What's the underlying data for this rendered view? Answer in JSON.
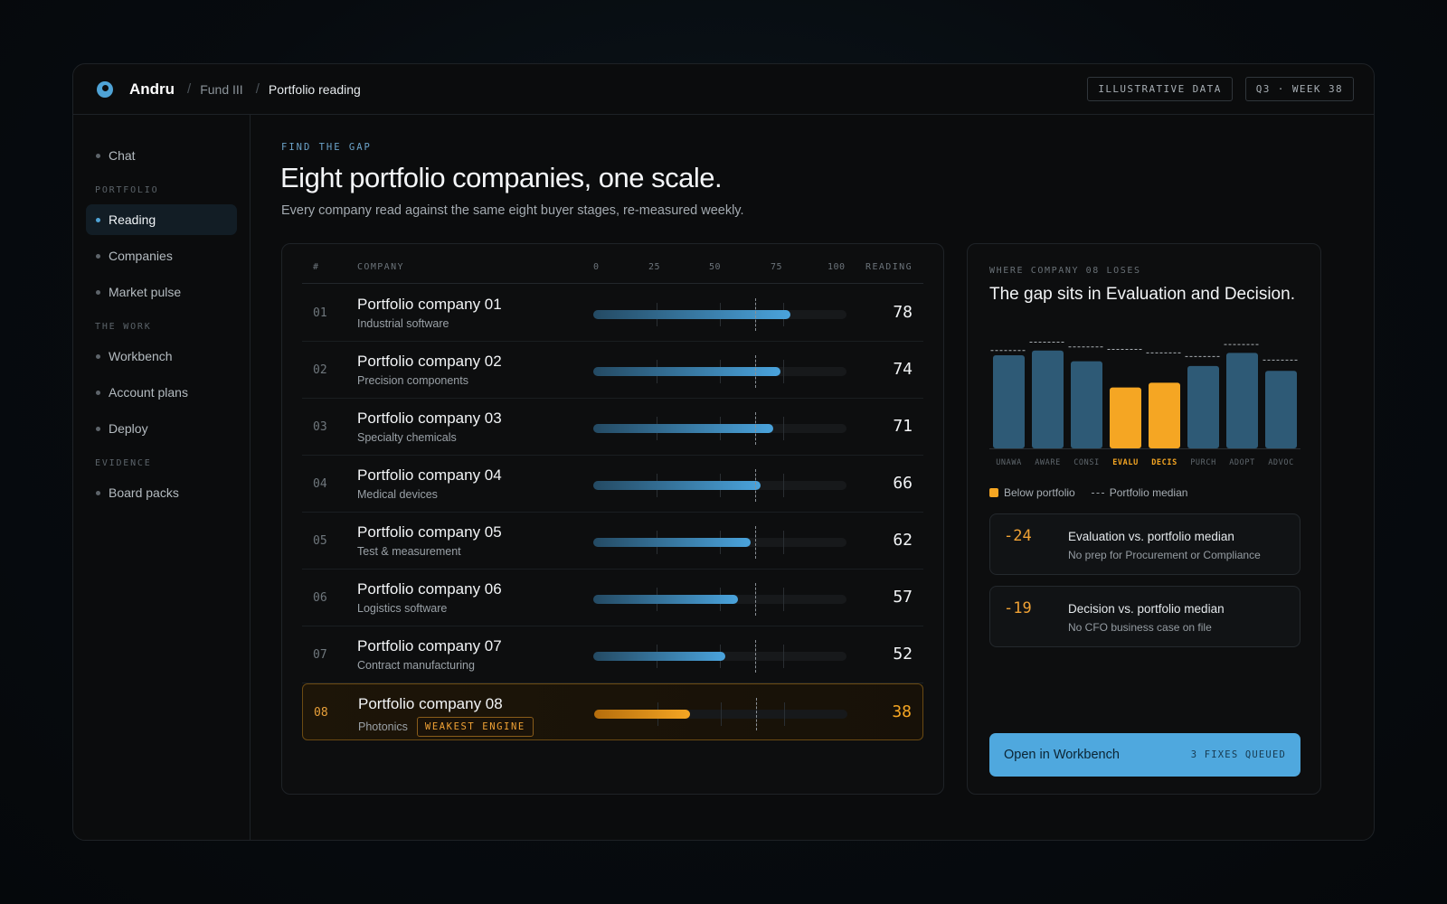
{
  "header": {
    "brand": "Andru",
    "breadcrumbs": [
      "Fund III",
      "Portfolio reading"
    ],
    "chips": [
      "ILLUSTRATIVE DATA",
      "Q3 · WEEK 38"
    ]
  },
  "sidebar": {
    "top_item": "Chat",
    "sections": [
      {
        "title": "PORTFOLIO",
        "items": [
          "Reading",
          "Companies",
          "Market pulse"
        ]
      },
      {
        "title": "THE WORK",
        "items": [
          "Workbench",
          "Account plans",
          "Deploy"
        ]
      },
      {
        "title": "EVIDENCE",
        "items": [
          "Board packs"
        ]
      }
    ],
    "active_item": "Reading"
  },
  "page": {
    "eyebrow": "FIND THE GAP",
    "title": "Eight portfolio companies, one scale.",
    "subtitle": "Every company read against the same eight buyer stages, re-measured weekly."
  },
  "table": {
    "headers": {
      "num": "#",
      "company": "COMPANY",
      "reading": "READING"
    },
    "scale_ticks": [
      "0",
      "25",
      "50",
      "75",
      "100"
    ],
    "median_value": 64,
    "rows": [
      {
        "num": "01",
        "name": "Portfolio company 01",
        "sector": "Industrial software",
        "reading": 78
      },
      {
        "num": "02",
        "name": "Portfolio company 02",
        "sector": "Precision components",
        "reading": 74
      },
      {
        "num": "03",
        "name": "Portfolio company 03",
        "sector": "Specialty chemicals",
        "reading": 71
      },
      {
        "num": "04",
        "name": "Portfolio company 04",
        "sector": "Medical devices",
        "reading": 66
      },
      {
        "num": "05",
        "name": "Portfolio company 05",
        "sector": "Test & measurement",
        "reading": 62
      },
      {
        "num": "06",
        "name": "Portfolio company 06",
        "sector": "Logistics software",
        "reading": 57
      },
      {
        "num": "07",
        "name": "Portfolio company 07",
        "sector": "Contract manufacturing",
        "reading": 52
      },
      {
        "num": "08",
        "name": "Portfolio company 08",
        "sector": "Photonics",
        "reading": 38,
        "badge": "WEAKEST ENGINE",
        "highlight": true
      }
    ]
  },
  "gap": {
    "eyebrow": "WHERE COMPANY 08 LOSES",
    "title": "The gap sits in Evaluation and Decision.",
    "legend_below": "Below portfolio",
    "legend_median": "Portfolio median",
    "metrics": [
      {
        "delta": "-24",
        "title": "Evaluation vs. portfolio median",
        "sub": "No prep for Procurement or Compliance"
      },
      {
        "delta": "-19",
        "title": "Decision vs. portfolio median",
        "sub": "No CFO business case on file"
      }
    ],
    "cta": {
      "label": "Open in Workbench",
      "count": "3 FIXES QUEUED"
    }
  },
  "chart_data": {
    "type": "bar",
    "categories": [
      "UNAWA",
      "AWARE",
      "CONSI",
      "EVALU",
      "DECIS",
      "PURCH",
      "ADOPT",
      "ADVOC"
    ],
    "values": [
      78,
      82,
      73,
      51,
      55,
      69,
      80,
      65
    ],
    "medians": [
      82,
      89,
      85,
      83,
      80,
      77,
      87,
      74
    ],
    "below_portfolio": [
      false,
      false,
      false,
      true,
      true,
      false,
      false,
      false
    ],
    "ylim": [
      0,
      100
    ],
    "colors": {
      "normal": "#2e5a76",
      "below": "#f5a623",
      "median_line": "#a9afb4"
    }
  },
  "colors": {
    "accent": "#4fa8de",
    "warning": "#f5a623"
  }
}
